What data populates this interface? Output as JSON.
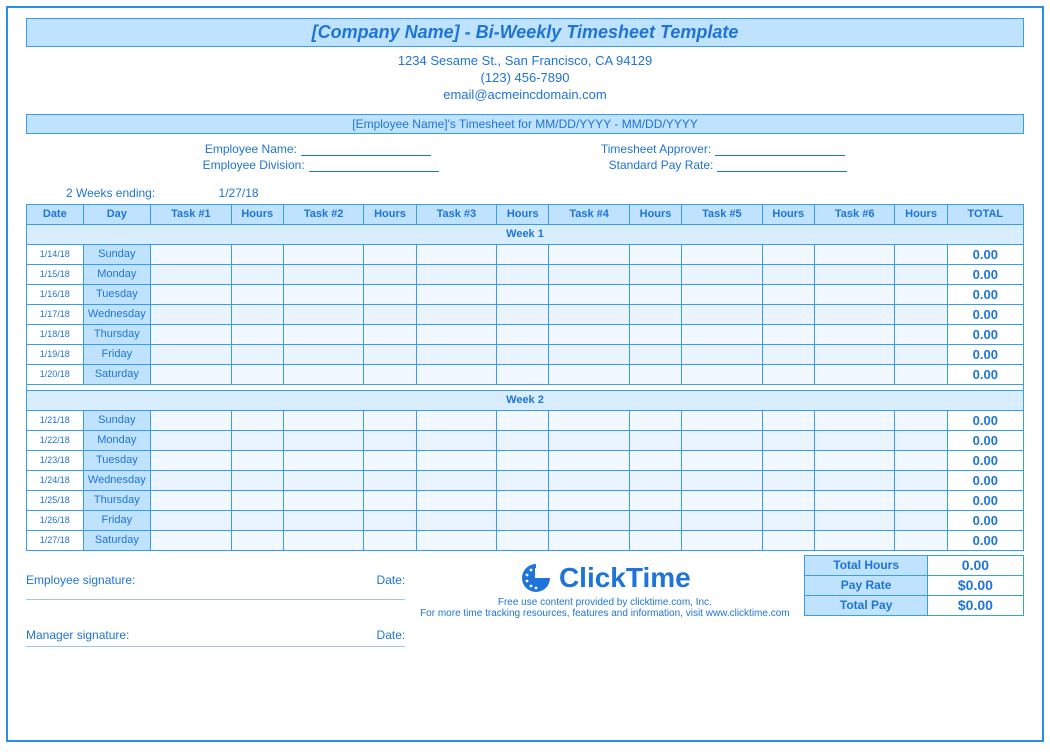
{
  "header": {
    "title": "[Company Name] - Bi-Weekly Timesheet Template",
    "address": "1234 Sesame St.,  San Francisco, CA 94129",
    "phone": "(123) 456-7890",
    "email": "email@acmeincdomain.com",
    "emp_band": "[Employee Name]'s Timesheet for MM/DD/YYYY - MM/DD/YYYY"
  },
  "info": {
    "emp_name_lbl": "Employee Name:",
    "emp_div_lbl": "Employee Division:",
    "approver_lbl": "Timesheet Approver:",
    "payrate_lbl": "Standard Pay Rate:",
    "weeks_ending_lbl": "2 Weeks ending:",
    "weeks_ending_val": "1/27/18"
  },
  "columns": {
    "date": "Date",
    "day": "Day",
    "t1": "Task #1",
    "h1": "Hours",
    "t2": "Task #2",
    "h2": "Hours",
    "t3": "Task #3",
    "h3": "Hours",
    "t4": "Task #4",
    "h4": "Hours",
    "t5": "Task #5",
    "h5": "Hours",
    "t6": "Task #6",
    "h6": "Hours",
    "total": "TOTAL"
  },
  "week_headers": {
    "w1": "Week 1",
    "w2": "Week 2"
  },
  "week1": [
    {
      "date": "1/14/18",
      "day": "Sunday",
      "total": "0.00"
    },
    {
      "date": "1/15/18",
      "day": "Monday",
      "total": "0.00"
    },
    {
      "date": "1/16/18",
      "day": "Tuesday",
      "total": "0.00"
    },
    {
      "date": "1/17/18",
      "day": "Wednesday",
      "total": "0.00"
    },
    {
      "date": "1/18/18",
      "day": "Thursday",
      "total": "0.00"
    },
    {
      "date": "1/19/18",
      "day": "Friday",
      "total": "0.00"
    },
    {
      "date": "1/20/18",
      "day": "Saturday",
      "total": "0.00"
    }
  ],
  "week2": [
    {
      "date": "1/21/18",
      "day": "Sunday",
      "total": "0.00"
    },
    {
      "date": "1/22/18",
      "day": "Monday",
      "total": "0.00"
    },
    {
      "date": "1/23/18",
      "day": "Tuesday",
      "total": "0.00"
    },
    {
      "date": "1/24/18",
      "day": "Wednesday",
      "total": "0.00"
    },
    {
      "date": "1/25/18",
      "day": "Thursday",
      "total": "0.00"
    },
    {
      "date": "1/26/18",
      "day": "Friday",
      "total": "0.00"
    },
    {
      "date": "1/27/18",
      "day": "Saturday",
      "total": "0.00"
    }
  ],
  "summary": {
    "total_hours_lbl": "Total Hours",
    "total_hours_val": "0.00",
    "pay_rate_lbl": "Pay Rate",
    "pay_rate_val": "$0.00",
    "total_pay_lbl": "Total Pay",
    "total_pay_val": "$0.00"
  },
  "signatures": {
    "emp_sig": "Employee signature:",
    "mgr_sig": "Manager signature:",
    "date_lbl": "Date:"
  },
  "brand": {
    "name": "ClickTime",
    "line1": "Free use content provided by clicktime.com, Inc.",
    "line2": "For more time tracking resources, features and information, visit www.clicktime.com"
  }
}
